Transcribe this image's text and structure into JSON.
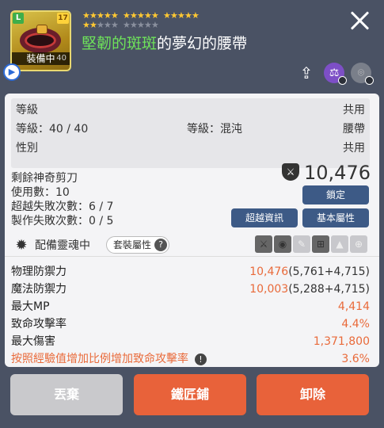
{
  "header": {
    "grade_badge": "L",
    "star_force_badge": "17",
    "equipped_label": "裝備中",
    "required_level": "40",
    "stars_filled": 17,
    "stars_total": 25,
    "item_name_prefix": "堅韌的斑斑",
    "item_name_suffix": "的夢幻的腰帶",
    "icons": [
      "share-icon",
      "scale-icon",
      "lock-icon"
    ]
  },
  "requirements": {
    "level_label": "等級",
    "level_value": "等級：40 / 40",
    "grade_value": "等級：混沌",
    "gender_label": "性別",
    "col_right_1": "共用",
    "col_right_2": "腰帶",
    "col_right_3": "共用"
  },
  "info": {
    "scissors": "剩餘神奇剪刀",
    "use_count": "使用數：10",
    "exceed_fail": "超越失敗次數：6 / 7",
    "craft_fail": "製作失敗次數：0 / 5",
    "power": "10,476",
    "lock_btn": "鎖定",
    "exceed_info_btn": "超越資訊",
    "basic_attr_btn": "基本屬性",
    "soul_label": "配備靈魂中",
    "set_attr_btn": "套裝屬性"
  },
  "stats": [
    {
      "name": "物理防禦力",
      "value_highlight": "10,476",
      "value_rest": "(5,761+4,715)"
    },
    {
      "name": "魔法防禦力",
      "value_highlight": "10,003",
      "value_rest": "(5,288+4,715)"
    },
    {
      "name": "最大MP",
      "value_highlight": "4,414",
      "value_rest": ""
    },
    {
      "name": "致命攻擊率",
      "value_highlight": "4.4%",
      "value_rest": ""
    },
    {
      "name": "最大傷害",
      "value_highlight": "1,371,800",
      "value_rest": ""
    },
    {
      "name": "按照經驗值增加比例增加致命攻擊率",
      "value_highlight": "3.6%",
      "value_rest": ""
    }
  ],
  "buttons": {
    "discard": "丟棄",
    "smith": "鐵匠鋪",
    "unequip": "卸除"
  },
  "colors": {
    "accent": "#e8623a",
    "button_blue": "#3d5a86",
    "header_bg": "#4a5264",
    "name_green": "#6ee35a"
  }
}
